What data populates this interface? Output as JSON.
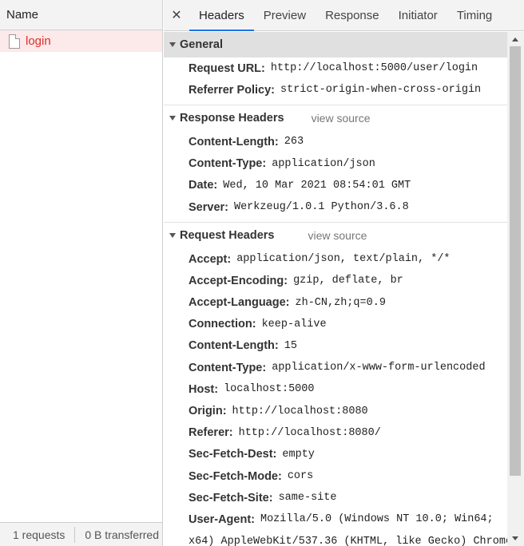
{
  "left_panel": {
    "column_header": "Name",
    "requests": [
      {
        "name": "login",
        "status_color": "#d9302c"
      }
    ],
    "footer": {
      "request_count": "1 requests",
      "transferred": "0 B transferred"
    }
  },
  "tabs": {
    "close_icon": "close-icon",
    "items": [
      "Headers",
      "Preview",
      "Response",
      "Initiator",
      "Timing"
    ],
    "active": "Headers",
    "accent_color": "#1a73e8"
  },
  "general": {
    "title": "General",
    "rows": [
      {
        "key": "Request URL:",
        "value": "http://localhost:5000/user/login"
      },
      {
        "key": "Referrer Policy:",
        "value": "strict-origin-when-cross-origin"
      }
    ]
  },
  "response_headers": {
    "title": "Response Headers",
    "view_source": "view source",
    "rows": [
      {
        "key": "Content-Length:",
        "value": "263"
      },
      {
        "key": "Content-Type:",
        "value": "application/json"
      },
      {
        "key": "Date:",
        "value": "Wed, 10 Mar 2021 08:54:01 GMT"
      },
      {
        "key": "Server:",
        "value": "Werkzeug/1.0.1 Python/3.6.8"
      }
    ]
  },
  "request_headers": {
    "title": "Request Headers",
    "view_source": "view source",
    "rows": [
      {
        "key": "Accept:",
        "value": "application/json, text/plain, */*"
      },
      {
        "key": "Accept-Encoding:",
        "value": "gzip, deflate, br"
      },
      {
        "key": "Accept-Language:",
        "value": "zh-CN,zh;q=0.9"
      },
      {
        "key": "Connection:",
        "value": "keep-alive"
      },
      {
        "key": "Content-Length:",
        "value": "15"
      },
      {
        "key": "Content-Type:",
        "value": "application/x-www-form-urlencoded"
      },
      {
        "key": "Host:",
        "value": "localhost:5000"
      },
      {
        "key": "Origin:",
        "value": "http://localhost:8080"
      },
      {
        "key": "Referer:",
        "value": "http://localhost:8080/"
      },
      {
        "key": "Sec-Fetch-Dest:",
        "value": "empty"
      },
      {
        "key": "Sec-Fetch-Mode:",
        "value": "cors"
      },
      {
        "key": "Sec-Fetch-Site:",
        "value": "same-site"
      },
      {
        "key": "User-Agent:",
        "value": "Mozilla/5.0 (Windows NT 10.0; Win64;"
      }
    ],
    "overflow_line": "x64) AppleWebKit/537.36 (KHTML, like Gecko) Chrome"
  }
}
